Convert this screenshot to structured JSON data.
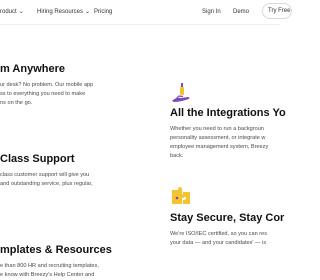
{
  "nav": {
    "items": [
      {
        "label": "roduct",
        "chevron": "chevron-down-icon"
      },
      {
        "label": "Hiring Resources",
        "chevron": "chevron-down-icon"
      },
      {
        "label": "Pricing"
      }
    ],
    "sign_in": "Sign In",
    "demo": "Demo",
    "cta": "Try Free"
  },
  "features": {
    "left": [
      {
        "title": "m Anywhere",
        "lines": [
          "ur desk? No problem. Our mobile app",
          "ss to everything you need to make",
          "ns on the go."
        ]
      },
      {
        "title": "Class Support",
        "lines": [
          "class customer support will give you",
          "and outstanding service, plus regular,"
        ]
      },
      {
        "title": "mplates & Resources",
        "lines": [
          "e than 800 HR and recruiting templates,",
          "e know with Breezy's Help Center and"
        ]
      }
    ],
    "right": [
      {
        "title": "All the Integrations Yo",
        "icon": "integration-hand-icon",
        "lines": [
          "Whether you need to run a backgroun",
          "personality assessment, or integrate w",
          "employee management system, Breezy",
          "back."
        ]
      },
      {
        "title": "Stay Secure, Stay Cor",
        "icon": "security-puzzle-icon",
        "lines": [
          "We're ISO/IEC certified, so you can res",
          "your data — and your candidates' — is"
        ]
      }
    ]
  },
  "colors": {
    "accent_purple": "#7b4bb7",
    "accent_yellow": "#f4c430",
    "heading": "#111111",
    "body": "#4a4a4a"
  }
}
